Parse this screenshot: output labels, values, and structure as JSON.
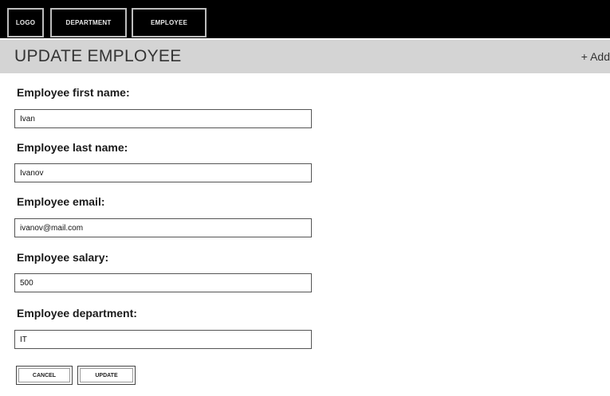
{
  "nav": {
    "logo": "LOGO",
    "department": "DEPARTMENT",
    "employee": "EMPLOYEE"
  },
  "header": {
    "title": "UPDATE EMPLOYEE",
    "add_link": "+ Add"
  },
  "form": {
    "first_name": {
      "label": "Employee first name:",
      "value": "Ivan"
    },
    "last_name": {
      "label": "Employee last name:",
      "value": "Ivanov"
    },
    "email": {
      "label": "Employee email:",
      "value": "ivanov@mail.com"
    },
    "salary": {
      "label": "Employee salary:",
      "value": "500"
    },
    "department": {
      "label": "Employee department:",
      "value": "IT"
    }
  },
  "buttons": {
    "cancel": "CANCEL",
    "update": "UPDATE"
  }
}
